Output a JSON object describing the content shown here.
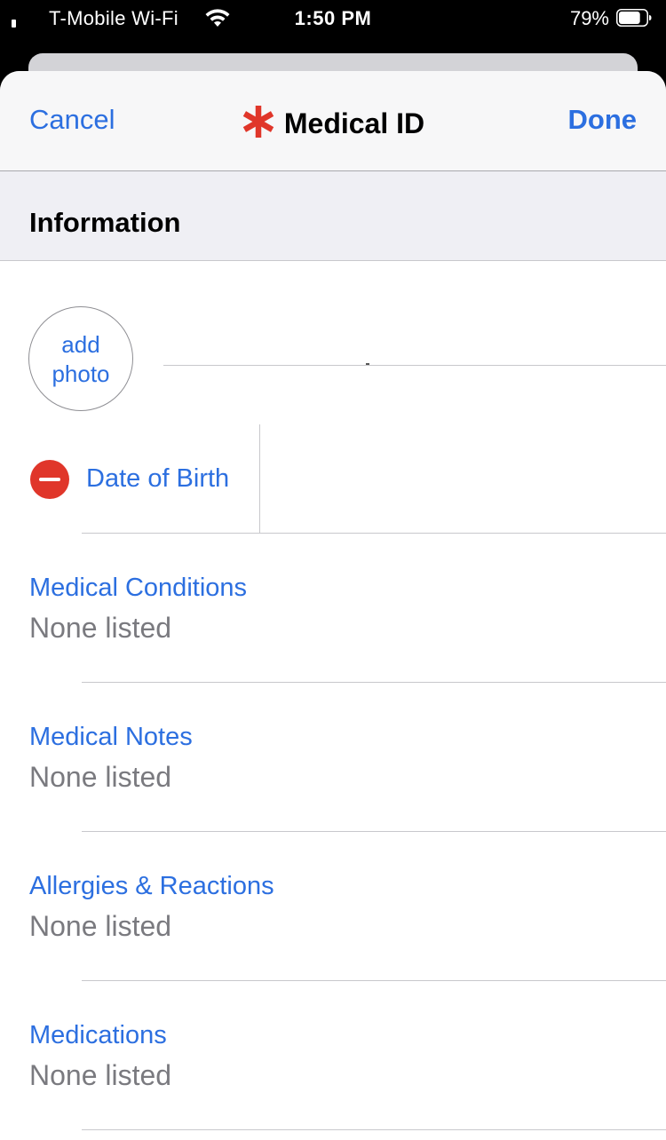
{
  "status_bar": {
    "carrier": "T-Mobile Wi-Fi",
    "time": "1:50 PM",
    "battery_percent": "79%",
    "battery_level": 0.79
  },
  "nav": {
    "cancel_label": "Cancel",
    "title": "Medical ID",
    "done_label": "Done",
    "title_icon": "medical-star-icon",
    "accent_color": "#2c6fe0",
    "icon_color": "#e0362a"
  },
  "section": {
    "title": "Information"
  },
  "photo": {
    "line1": "add",
    "line2": "photo"
  },
  "dob": {
    "label": "Date of Birth",
    "remove_icon": "minus-circle-icon"
  },
  "fields": [
    {
      "label": "Medical Conditions",
      "value": "None listed"
    },
    {
      "label": "Medical Notes",
      "value": "None listed"
    },
    {
      "label": "Allergies & Reactions",
      "value": "None listed"
    },
    {
      "label": "Medications",
      "value": "None listed"
    }
  ]
}
